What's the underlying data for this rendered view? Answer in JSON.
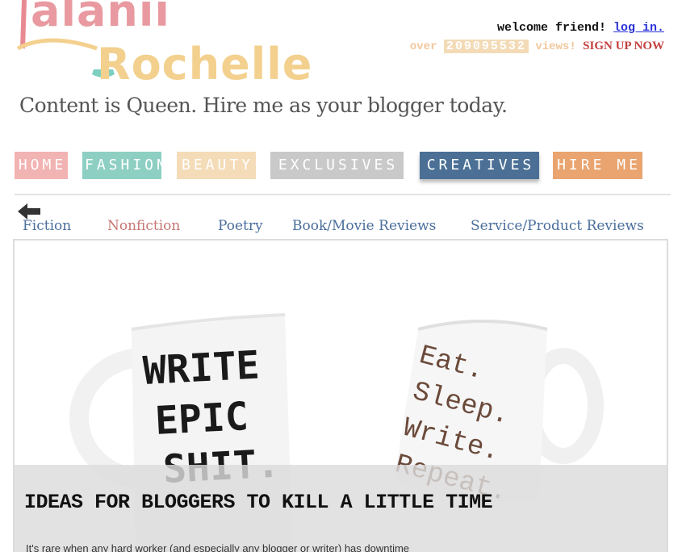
{
  "site": {
    "logo_line1": "alanii",
    "logo_line2": "Rochelle",
    "tagline": "Content is Queen. Hire me as your blogger today."
  },
  "header": {
    "welcome_text": "welcome friend!",
    "login_label": "log in.",
    "views_prefix": "over",
    "views_count": "209095532",
    "views_suffix": "views!",
    "signup_label": "SIGN UP NOW"
  },
  "main_nav": [
    {
      "label": "HOME",
      "color": "#f2b3b3"
    },
    {
      "label": "FASHION",
      "color": "#8ecfc3"
    },
    {
      "label": "BEAUTY",
      "color": "#f4dcb8"
    },
    {
      "label": "EXCLUSIVES",
      "color": "#c9c9c9"
    },
    {
      "label": "CREATIVES",
      "color": "#4b6f95"
    },
    {
      "label": "HIRE ME",
      "color": "#e9a46f"
    }
  ],
  "sub_nav": {
    "back_icon": "arrow-left-icon",
    "items": [
      {
        "label": "Fiction"
      },
      {
        "label": "Nonfiction",
        "active": true
      },
      {
        "label": "Poetry"
      },
      {
        "label": "Book/Movie Reviews"
      },
      {
        "label": "Service/Product Reviews"
      }
    ]
  },
  "post": {
    "title": "IDEAS FOR BLOGGERS TO KILL A LITTLE TIME",
    "excerpt": "It's rare when any hard worker (and especially any blogger or writer) has downtime",
    "mug_left_lines": [
      "WRITE",
      "EPIC",
      "SHIT."
    ],
    "mug_right_lines": [
      "Eat.",
      "Sleep.",
      "Write.",
      "Repeat."
    ]
  }
}
